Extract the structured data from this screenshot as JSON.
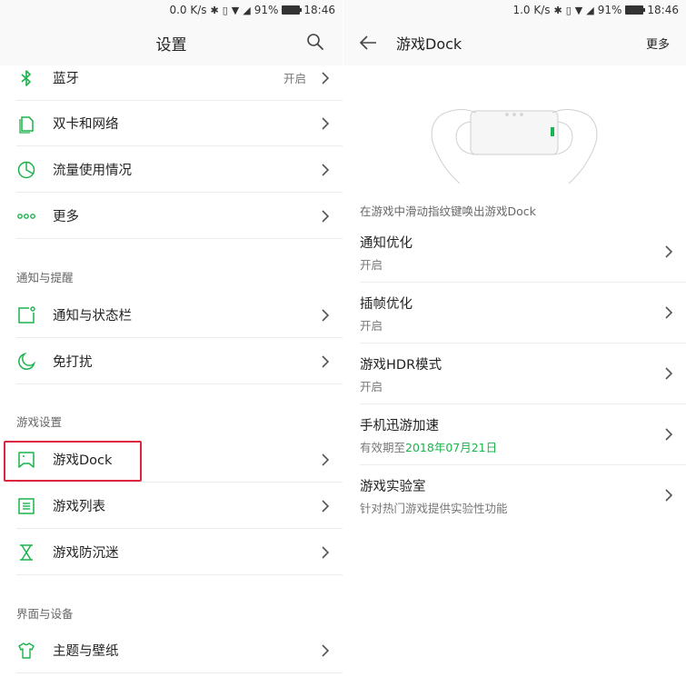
{
  "left": {
    "status": {
      "speed": "0.0 K/s",
      "battery": "91%",
      "time": "18:46"
    },
    "title": "设置",
    "items_top": [
      {
        "label": "蓝牙",
        "value": "开启"
      },
      {
        "label": "双卡和网络"
      },
      {
        "label": "流量使用情况"
      },
      {
        "label": "更多"
      }
    ],
    "section_notify": "通知与提醒",
    "items_notify": [
      {
        "label": "通知与状态栏"
      },
      {
        "label": "免打扰"
      }
    ],
    "section_game": "游戏设置",
    "items_game": [
      {
        "label": "游戏Dock"
      },
      {
        "label": "游戏列表"
      },
      {
        "label": "游戏防沉迷"
      }
    ],
    "section_ui": "界面与设备",
    "items_ui": [
      {
        "label": "主题与壁纸"
      }
    ]
  },
  "right": {
    "status": {
      "speed": "1.0 K/s",
      "battery": "91%",
      "time": "18:46"
    },
    "title": "游戏Dock",
    "more": "更多",
    "hint": "在游戏中滑动指纹键唤出游戏Dock",
    "rows": [
      {
        "title": "通知优化",
        "sub": "开启"
      },
      {
        "title": "插帧优化",
        "sub": "开启"
      },
      {
        "title": "游戏HDR模式",
        "sub": "开启"
      },
      {
        "title": "手机迅游加速",
        "sub_prefix": "有效期至",
        "sub_highlight": "2018年07月21日"
      },
      {
        "title": "游戏实验室",
        "sub": "针对热门游戏提供实验性功能"
      }
    ]
  },
  "colors": {
    "accent": "#1bb34b",
    "highlight_box": "#e0263f"
  },
  "icons": [
    "bluetooth-icon",
    "sim-card-icon",
    "pie-chart-icon",
    "more-dots-icon",
    "notification-icon",
    "moon-icon",
    "game-dock-icon",
    "list-icon",
    "hourglass-icon",
    "shirt-icon",
    "search-icon",
    "back-arrow-icon",
    "chevron-right-icon"
  ]
}
